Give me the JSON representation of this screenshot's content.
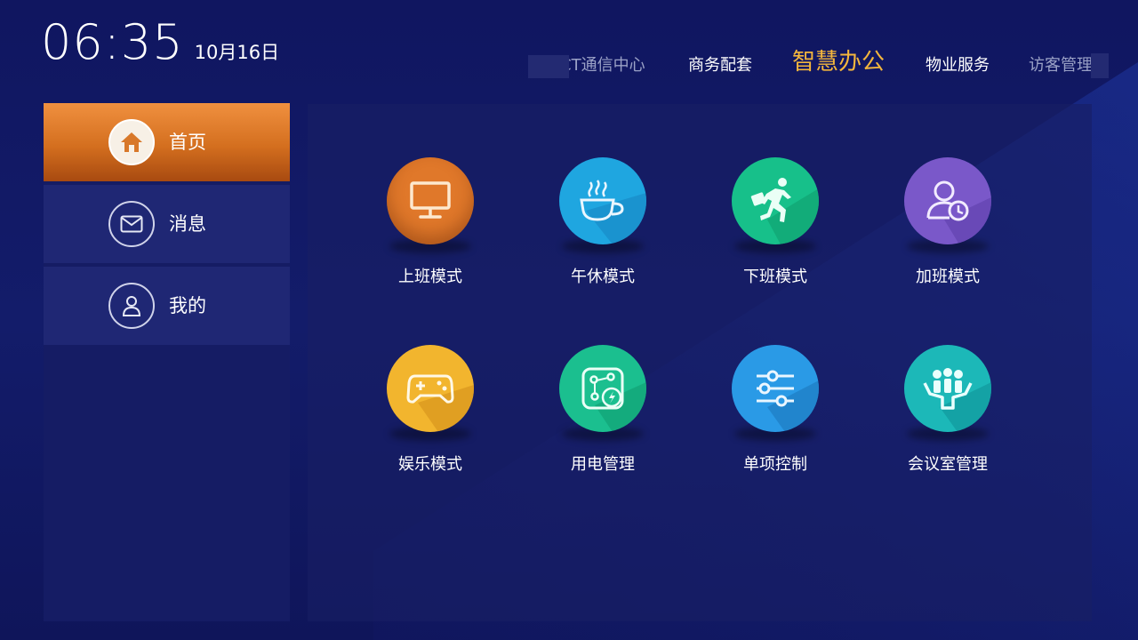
{
  "header": {
    "time": "06:35",
    "date": "10月16日"
  },
  "top_nav": [
    {
      "label": "CT通信中心",
      "state": "dim"
    },
    {
      "label": "商务配套",
      "state": "normal"
    },
    {
      "label": "智慧办公",
      "state": "active"
    },
    {
      "label": "物业服务",
      "state": "normal"
    },
    {
      "label": "访客管理",
      "state": "dim"
    }
  ],
  "sidebar": {
    "items": [
      {
        "label": "首页",
        "icon": "home-icon",
        "active": true
      },
      {
        "label": "消息",
        "icon": "mail-icon",
        "active": false
      },
      {
        "label": "我的",
        "icon": "user-icon",
        "active": false
      }
    ]
  },
  "tiles": [
    {
      "label": "上班模式",
      "icon": "monitor-icon",
      "color": "#e0782a"
    },
    {
      "label": "午休模式",
      "icon": "coffee-cup-icon",
      "color": "#1fa6e0"
    },
    {
      "label": "下班模式",
      "icon": "running-man-icon",
      "color": "#17c08a"
    },
    {
      "label": "加班模式",
      "icon": "user-clock-icon",
      "color": "#7a58c9"
    },
    {
      "label": "娱乐模式",
      "icon": "gamepad-icon",
      "color": "#f2b52e"
    },
    {
      "label": "用电管理",
      "icon": "power-network-icon",
      "color": "#1bbf8f"
    },
    {
      "label": "单项控制",
      "icon": "sliders-icon",
      "color": "#2a9ae6"
    },
    {
      "label": "会议室管理",
      "icon": "meeting-icon",
      "color": "#1cb8b8"
    }
  ],
  "colors": {
    "accent": "#f3b63d",
    "background": "#121a5e",
    "sidebar_active": "#d4701f"
  }
}
